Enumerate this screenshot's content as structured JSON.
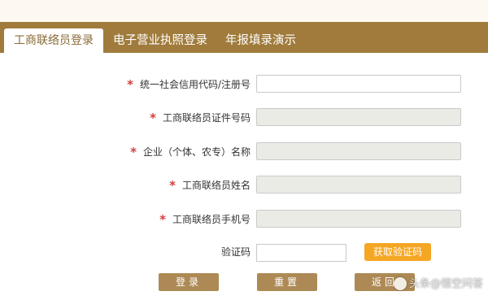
{
  "tabs": [
    {
      "label": "工商联络员登录",
      "active": true
    },
    {
      "label": "电子营业执照登录",
      "active": false
    },
    {
      "label": "年报填录演示",
      "active": false
    }
  ],
  "form": {
    "required_mark": "*",
    "fields": [
      {
        "label": "统一社会信用代码/注册号",
        "value": "",
        "enabled": true
      },
      {
        "label": "工商联络员证件号码",
        "value": "",
        "enabled": false
      },
      {
        "label": "企业（个体、农专）名称",
        "value": "",
        "enabled": false
      },
      {
        "label": "工商联络员姓名",
        "value": "",
        "enabled": false
      },
      {
        "label": "工商联络员手机号",
        "value": "",
        "enabled": false
      }
    ],
    "captcha_label": "验证码",
    "captcha_value": "",
    "get_code_label": "获取验证码"
  },
  "actions": {
    "login_label": "登录",
    "reset_label": "重置",
    "back_label": "返回"
  },
  "watermark": "头条@悟空问答",
  "colors": {
    "tab_bar": "#a07b3c",
    "required": "#d23f3f",
    "get_code": "#f5a623",
    "action_button": "#ad8a55",
    "disabled_field": "#ebebe6"
  }
}
